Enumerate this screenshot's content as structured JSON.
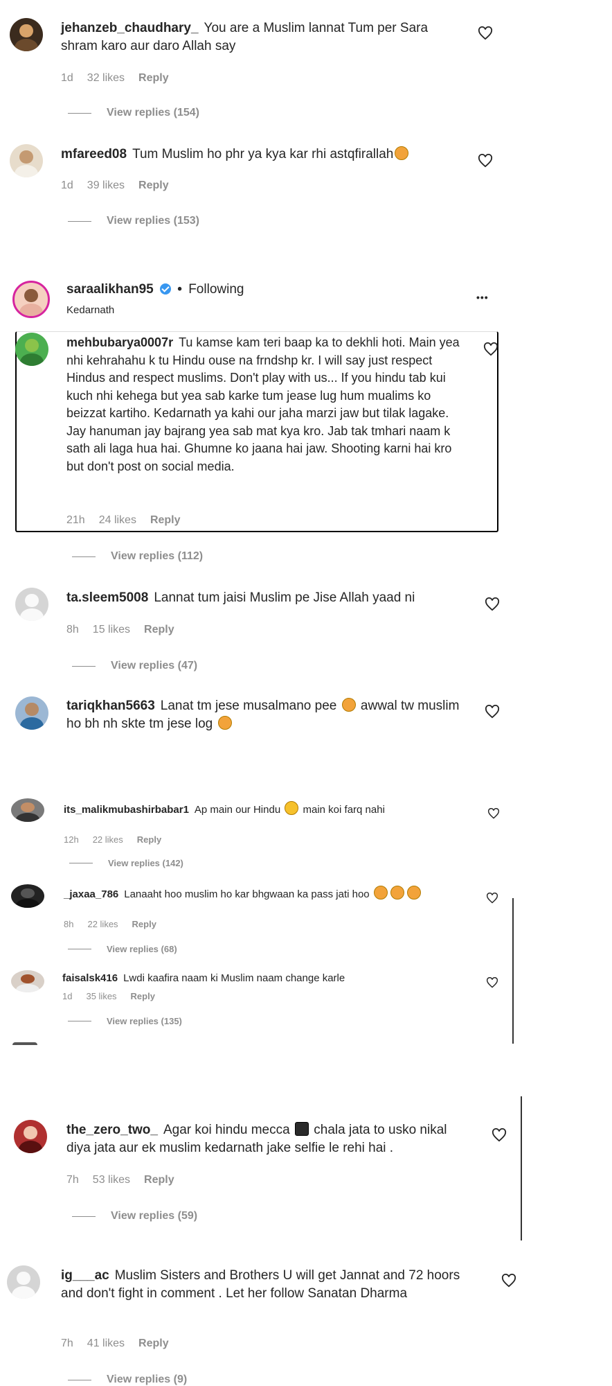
{
  "comments": [
    {
      "user": "jehanzeb_chaudhary_",
      "text": "You are a Muslim lannat Tum per Sara shram karo aur daro Allah say",
      "time": "1d",
      "likes": "32 likes",
      "reply": "Reply",
      "view": "View replies (154)"
    },
    {
      "user": "mfareed08",
      "text": "Tum Muslim ho phr ya kya kar rhi astqfirallah",
      "time": "1d",
      "likes": "39 likes",
      "reply": "Reply",
      "view": "View replies (153)"
    },
    {
      "user": "mehbubarya0007r",
      "text": "Tu kamse kam teri baap ka to dekhli hoti. Main yea nhi kehrahahu k tu Hindu ouse na frndshp kr. I will say just respect Hindus and respect muslims. Don't play with us... If you hindu tab kui kuch nhi kehega but yea sab karke tum jease lug hum mualims ko beizzat kartiho. Kedarnath ya kahi our jaha marzi jaw but tilak lagake. Jay hanuman jay bajrang yea sab mat kya kro. Jab tak tmhari naam k sath ali laga hua hai. Ghumne ko jaana hai jaw. Shooting karni hai kro but don't post on social media.",
      "time": "21h",
      "likes": "24 likes",
      "reply": "Reply",
      "view": "View replies (112)"
    },
    {
      "user": "ta.sleem5008",
      "text": "Lannat tum jaisi Muslim pe Jise Allah yaad ni",
      "time": "8h",
      "likes": "15 likes",
      "reply": "Reply",
      "view": "View replies (47)"
    },
    {
      "user": "tariqkhan5663",
      "text": "Lanat tm jese musalmano pee",
      "text2": "awwal tw muslim ho bh nh skte tm jese log"
    },
    {
      "user": "its_malikmubashirbabar1",
      "text": "Ap main our Hindu",
      "text2": "main koi farq nahi",
      "time": "12h",
      "likes": "22 likes",
      "reply": "Reply",
      "view": "View replies (142)"
    },
    {
      "user": "_jaxaa_786",
      "text": "Lanaaht hoo muslim ho kar bhgwaan ka pass jati hoo",
      "time": "8h",
      "likes": "22 likes",
      "reply": "Reply",
      "view": "View replies (68)"
    },
    {
      "user": "faisalsk416",
      "text": "Lwdi kaafira naam ki Muslim naam change karle",
      "time": "1d",
      "likes": "35 likes",
      "reply": "Reply",
      "view": "View replies (135)"
    },
    {
      "user": "the_zero_two_",
      "text": "Agar koi hindu mecca",
      "text2": "chala jata to usko nikal diya jata aur ek muslim kedarnath jake selfie le rehi hai .",
      "time": "7h",
      "likes": "53 likes",
      "reply": "Reply",
      "view": "View replies (59)"
    },
    {
      "user": "ig___ac",
      "text": "Muslim Sisters and Brothers U will get Jannat and 72 hoors and don't fight in comment . Let her follow Sanatan Dharma",
      "time": "7h",
      "likes": "41 likes",
      "reply": "Reply",
      "view": "View replies (9)"
    }
  ],
  "post": {
    "user": "saraalikhan95",
    "separator": "•",
    "following": "Following",
    "location": "Kedarnath",
    "more": "•••"
  },
  "colors": {
    "verified": "#3897f0",
    "secondary": "#8e8e8e",
    "text": "#262626"
  }
}
